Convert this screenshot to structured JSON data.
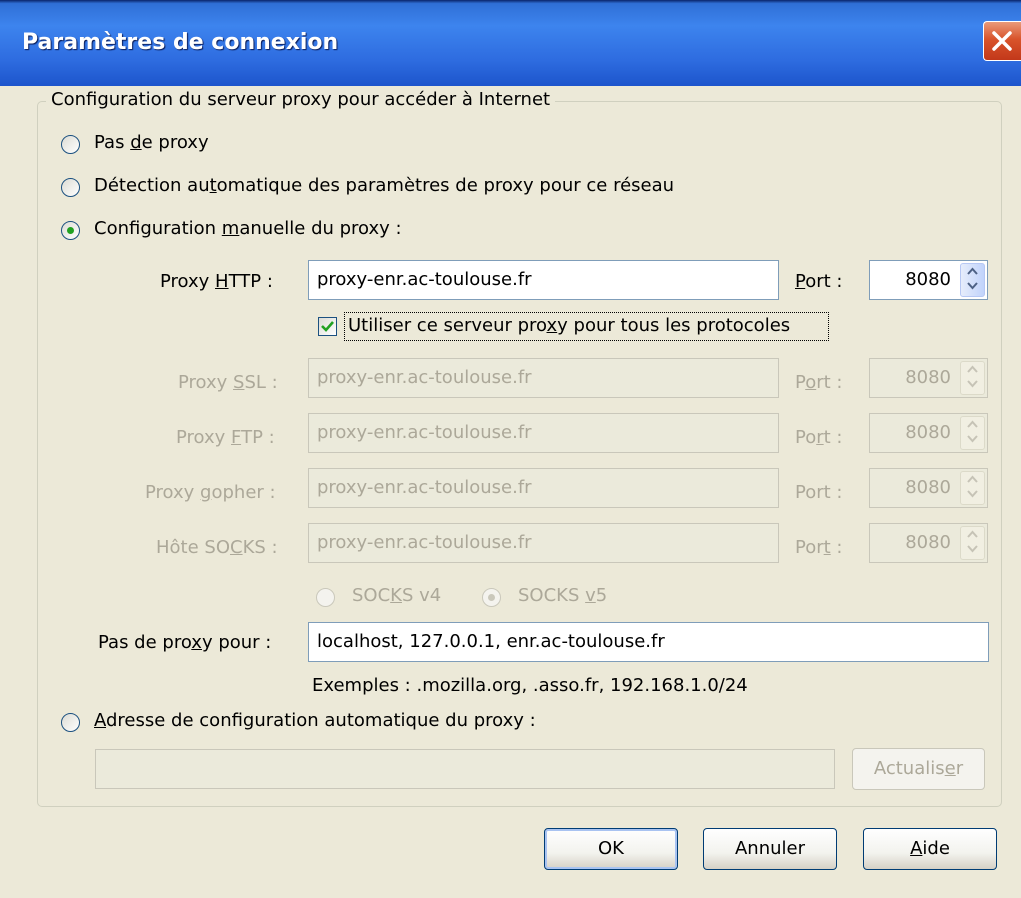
{
  "window": {
    "title": "Paramètres de connexion"
  },
  "group": {
    "legend": "Configuration du serveur proxy pour accéder à Internet"
  },
  "options": {
    "no_proxy": {
      "pre": "Pas ",
      "key": "d",
      "post": "e proxy"
    },
    "auto_detect": {
      "pre": "Détection au",
      "key": "t",
      "post": "omatique des paramètres de proxy pour ce réseau"
    },
    "manual": {
      "pre": "Configuration ",
      "key": "m",
      "post": "anuelle du proxy :"
    },
    "auto_url": {
      "pre": "",
      "key": "A",
      "post": "dresse de configuration automatique du proxy :"
    }
  },
  "selected_option": "manual",
  "http": {
    "label_pre": "Proxy ",
    "label_key": "H",
    "label_post": "TTP :",
    "value": "proxy-enr.ac-toulouse.fr",
    "port_label_key": "P",
    "port_label_post": "ort :",
    "port": "8080"
  },
  "share_all": {
    "pre": "Utiliser ce serveur pro",
    "key": "x",
    "post": "y pour tous les protocoles",
    "checked": true
  },
  "ssl": {
    "label_pre": "Proxy ",
    "label_key": "S",
    "label_post": "SL :",
    "value": "proxy-enr.ac-toulouse.fr",
    "port_label_pre": "P",
    "port_label_key": "o",
    "port_label_post": "rt :",
    "port": "8080"
  },
  "ftp": {
    "label_pre": "Proxy ",
    "label_key": "F",
    "label_post": "TP :",
    "value": "proxy-enr.ac-toulouse.fr",
    "port_label_pre": "Po",
    "port_label_key": "r",
    "port_label_post": "t :",
    "port": "8080"
  },
  "gopher": {
    "label_pre": "Proxy ",
    "label_key": "g",
    "label_post": "opher :",
    "value": "proxy-enr.ac-toulouse.fr",
    "port_label": "Port :",
    "port": "8080"
  },
  "socks": {
    "label_pre": "Hôte SO",
    "label_key": "C",
    "label_post": "KS :",
    "value": "proxy-enr.ac-toulouse.fr",
    "port_label_pre": "Por",
    "port_label_key": "t",
    "port_label_post": " :",
    "port": "8080",
    "v4": {
      "pre": "SOC",
      "key": "K",
      "post": "S v4"
    },
    "v5": {
      "pre": "SOCKS ",
      "key": "v",
      "post": "5"
    },
    "selected": "v5"
  },
  "no_proxy_for": {
    "label_pre": "Pas de pro",
    "label_key": "x",
    "label_post": "y pour :",
    "value": "localhost, 127.0.0.1, enr.ac-toulouse.fr",
    "examples": "Exemples : .mozilla.org, .asso.fr, 192.168.1.0/24"
  },
  "auto_url_value": "",
  "reload_button": {
    "pre": "Actualis",
    "key": "e",
    "post": "r"
  },
  "buttons": {
    "ok": "OK",
    "cancel": "Annuler",
    "help_key": "A",
    "help_post": "ide"
  },
  "colors": {
    "titlebar": "#2e6ce0",
    "dialog_bg": "#ece9d8",
    "close_button": "#d9542b",
    "radio_check": "#21a121",
    "disabled_text": "#aca899"
  }
}
